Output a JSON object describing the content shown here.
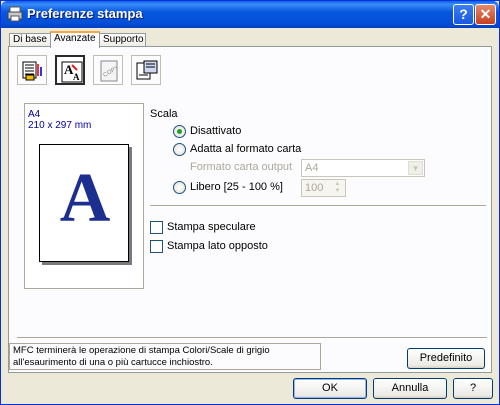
{
  "window": {
    "title": "Preferenze stampa",
    "help_glyph": "?",
    "close_glyph": "✕"
  },
  "tabs": [
    {
      "label": "Di base",
      "active": false
    },
    {
      "label": "Avanzate",
      "active": true
    },
    {
      "label": "Supporto",
      "active": false
    }
  ],
  "toolbar_icons": [
    "print-quality-icon",
    "scale-icon",
    "watermark-icon",
    "page-setup-icon"
  ],
  "preview": {
    "paper_name": "A4",
    "paper_dims": "210 x 297 mm",
    "letter": "A"
  },
  "scale": {
    "heading": "Scala",
    "options": [
      {
        "label": "Disattivato",
        "checked": true
      },
      {
        "label": "Adatta al formato carta",
        "checked": false
      },
      {
        "label": "Libero [25 - 100 %]",
        "checked": false
      }
    ],
    "output_label": "Formato carta output",
    "output_value": "A4",
    "free_value": "100"
  },
  "options": {
    "mirror": {
      "label": "Stampa speculare",
      "checked": false
    },
    "reverse": {
      "label": "Stampa lato opposto",
      "checked": false
    }
  },
  "info_text": "MFC terminerà le operazione di stampa Colori/Scale di grigio all'esaurimento di una o più cartucce inchiostro.",
  "buttons": {
    "default": "Predefinito",
    "ok": "OK",
    "cancel": "Annulla",
    "help": "?"
  }
}
